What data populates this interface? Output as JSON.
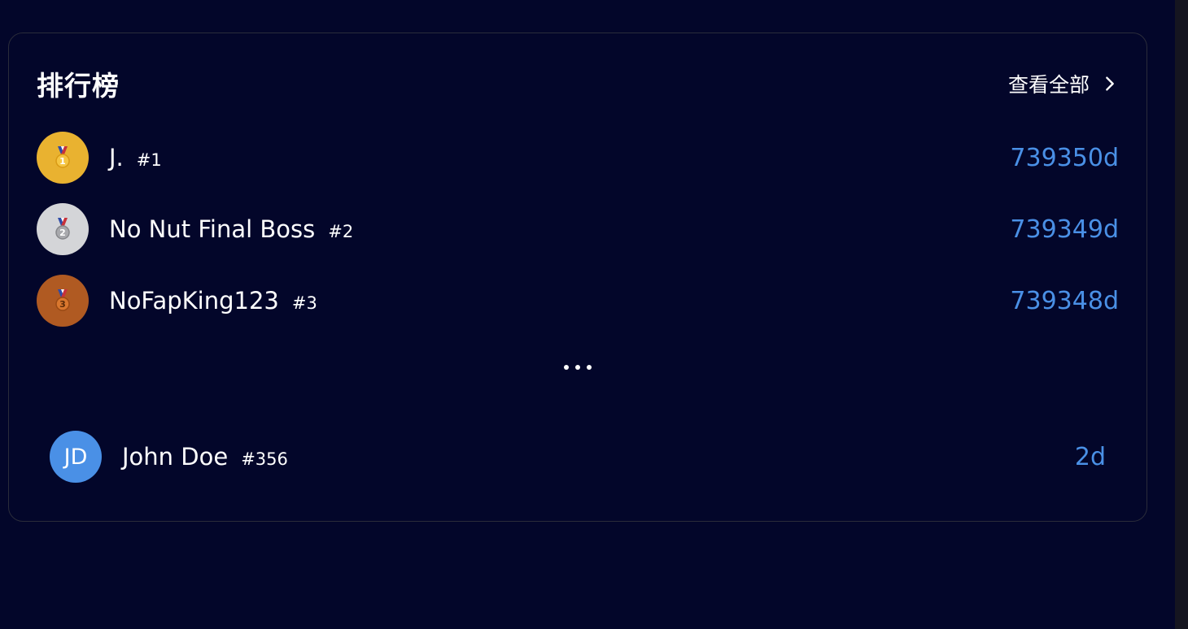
{
  "leaderboard": {
    "title": "排行榜",
    "view_all_label": "查看全部",
    "top": [
      {
        "medal": "gold-medal-icon",
        "medal_number": "1",
        "name": "J.",
        "rank": "#1",
        "score": "739350d"
      },
      {
        "medal": "silver-medal-icon",
        "medal_number": "2",
        "name": "No Nut Final Boss",
        "rank": "#2",
        "score": "739349d"
      },
      {
        "medal": "bronze-medal-icon",
        "medal_number": "3",
        "name": "NoFapKing123",
        "rank": "#3",
        "score": "739348d"
      }
    ],
    "current_user": {
      "initials": "JD",
      "name": "John Doe",
      "rank": "#356",
      "score": "2d"
    }
  },
  "colors": {
    "background": "#03062a",
    "accent": "#4a90e6",
    "gold": "#e9b230",
    "silver": "#d4d5d8",
    "bronze": "#b05a22",
    "card_border": "#2a2c3a"
  }
}
